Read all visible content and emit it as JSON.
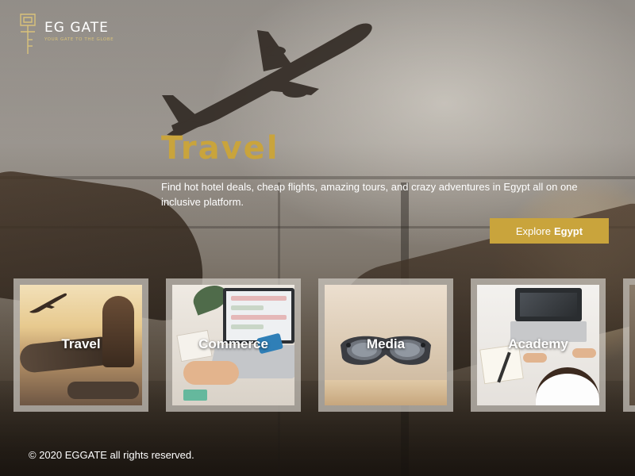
{
  "brand": {
    "name": "EG GATE",
    "tagline": "YOUR GATE TO THE GLOBE"
  },
  "hero": {
    "title": "Travel",
    "description": "Find hot hotel deals, cheap flights, amazing tours, and crazy adventures in Egypt all on one inclusive platform.",
    "cta_prefix": "Explore",
    "cta_bold": "Egypt"
  },
  "categories": [
    {
      "label": "Travel",
      "icon": "travel-photo"
    },
    {
      "label": "Commerce",
      "icon": "commerce-photo"
    },
    {
      "label": "Media",
      "icon": "media-photo"
    },
    {
      "label": "Academy",
      "icon": "academy-photo"
    }
  ],
  "footer": {
    "copyright": "© 2020 EGGATE all rights reserved."
  },
  "colors": {
    "accent": "#c9a43c",
    "text": "#ffffff",
    "card_frame": "#d2cdc6"
  }
}
